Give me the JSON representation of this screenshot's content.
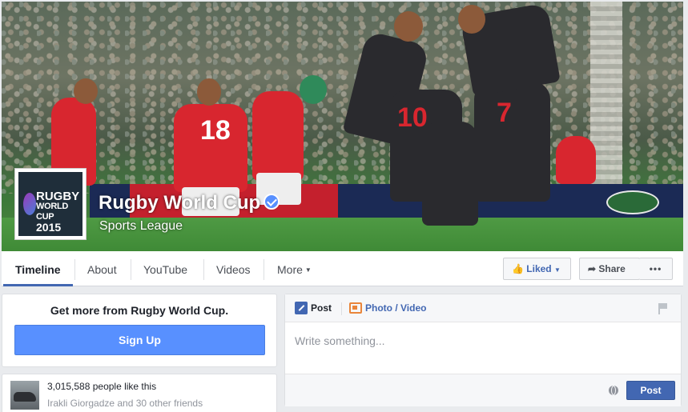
{
  "page": {
    "name": "Rugby World Cup",
    "category": "Sports League",
    "profile_logo": {
      "line1": "RUGBY",
      "line2": "WORLD CUP",
      "line3": "2015"
    },
    "cover_numbers": [
      "18",
      "7",
      "10"
    ]
  },
  "nav": {
    "tabs": [
      {
        "label": "Timeline",
        "active": true
      },
      {
        "label": "About",
        "active": false
      },
      {
        "label": "YouTube",
        "active": false
      },
      {
        "label": "Videos",
        "active": false
      },
      {
        "label": "More",
        "active": false
      }
    ],
    "liked_label": "Liked",
    "share_label": "Share",
    "more_dots": "•••"
  },
  "signup": {
    "title": "Get more from Rugby World Cup.",
    "button_label": "Sign Up"
  },
  "likes": {
    "count_text": "3,015,588 people like this",
    "friends_text": "Irakli Giorgadze and 30 other friends"
  },
  "composer": {
    "tab_post": "Post",
    "tab_photo_video": "Photo / Video",
    "placeholder": "Write something...",
    "post_button": "Post"
  },
  "colors": {
    "fb_blue": "#4267b2",
    "signup_blue": "#5890ff",
    "background": "#e9ebee"
  }
}
